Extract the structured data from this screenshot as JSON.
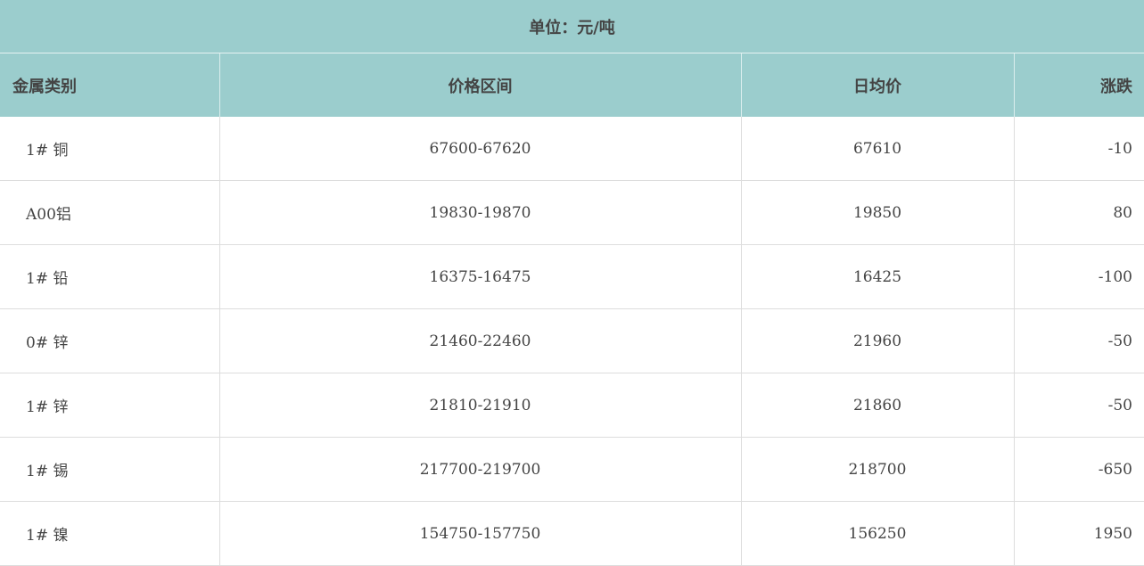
{
  "unit_label": "单位：元/吨",
  "columns": [
    "金属类别",
    "价格区间",
    "日均价",
    "涨跌"
  ],
  "rows": [
    {
      "metal": "1# 铜",
      "range": "67600-67620",
      "avg": "67610",
      "change": "-10"
    },
    {
      "metal": "A00铝",
      "range": "19830-19870",
      "avg": "19850",
      "change": "80"
    },
    {
      "metal": "1# 铅",
      "range": "16375-16475",
      "avg": "16425",
      "change": "-100"
    },
    {
      "metal": "0# 锌",
      "range": "21460-22460",
      "avg": "21960",
      "change": "-50"
    },
    {
      "metal": "1# 锌",
      "range": "21810-21910",
      "avg": "21860",
      "change": "-50"
    },
    {
      "metal": "1# 锡",
      "range": "217700-219700",
      "avg": "218700",
      "change": "-650"
    },
    {
      "metal": "1# 镍",
      "range": "154750-157750",
      "avg": "156250",
      "change": "1950"
    }
  ],
  "colors": {
    "header_bg": "#9bcdcd",
    "text": "#444444",
    "grid": "#dddddd"
  }
}
